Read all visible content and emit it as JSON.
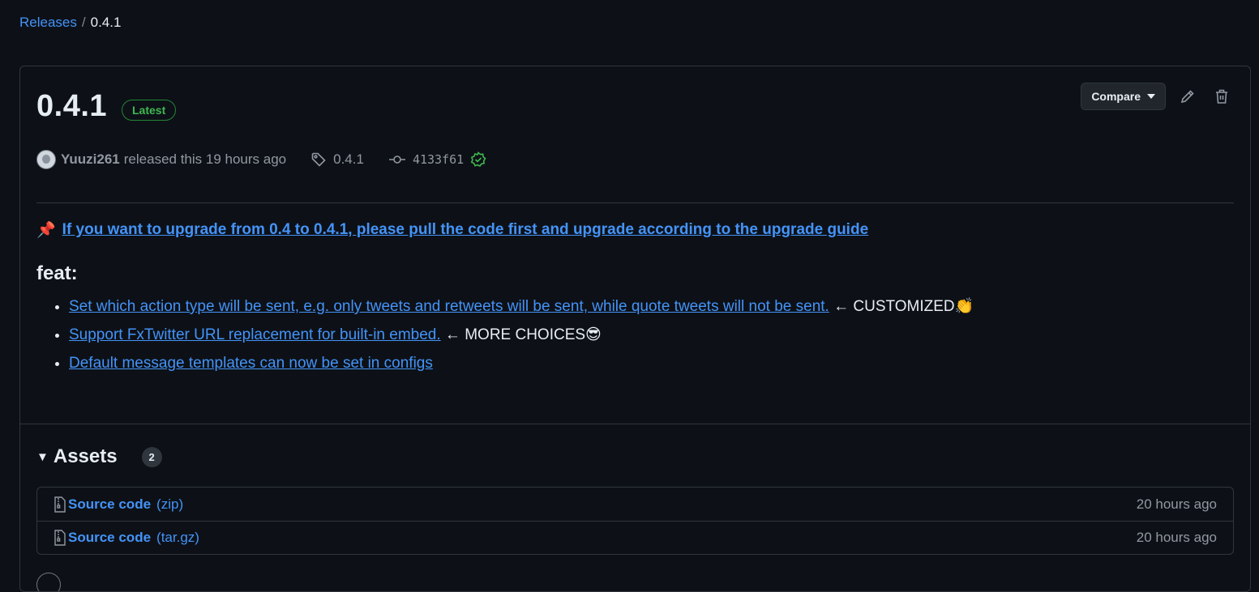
{
  "breadcrumb": {
    "releases_label": "Releases",
    "separator": "/",
    "current": "0.4.1"
  },
  "release": {
    "title": "0.4.1",
    "latest_badge": "Latest",
    "compare_label": "Compare",
    "author": "Yuuzi261",
    "released_text": "released this 19 hours ago",
    "tag": "0.4.1",
    "commit": "4133f61",
    "verified_color": "#3fb950"
  },
  "notes": {
    "pin_emoji": "📌",
    "notice_link": "If you want to upgrade from 0.4 to 0.4.1, please pull the code first and upgrade according to the upgrade guide",
    "heading": "feat:",
    "items": [
      {
        "link": "Set which action type will be sent, e.g. only tweets and retweets will be sent, while quote tweets will not be sent.",
        "suffix": " ← CUSTOMIZED👏"
      },
      {
        "link": "Support FxTwitter URL replacement for built-in embed.",
        "suffix": " ← MORE CHOICES😎"
      },
      {
        "link": "Default message templates can now be set in configs",
        "suffix": ""
      }
    ]
  },
  "assets": {
    "heading": "Assets",
    "count": "2",
    "rows": [
      {
        "name": "Source code",
        "ext": "(zip)",
        "date": "20 hours ago"
      },
      {
        "name": "Source code",
        "ext": "(tar.gz)",
        "date": "20 hours ago"
      }
    ]
  },
  "colors": {
    "background": "#0d1117",
    "link": "#4493f8",
    "border": "#30363d",
    "success": "#3fb950"
  }
}
